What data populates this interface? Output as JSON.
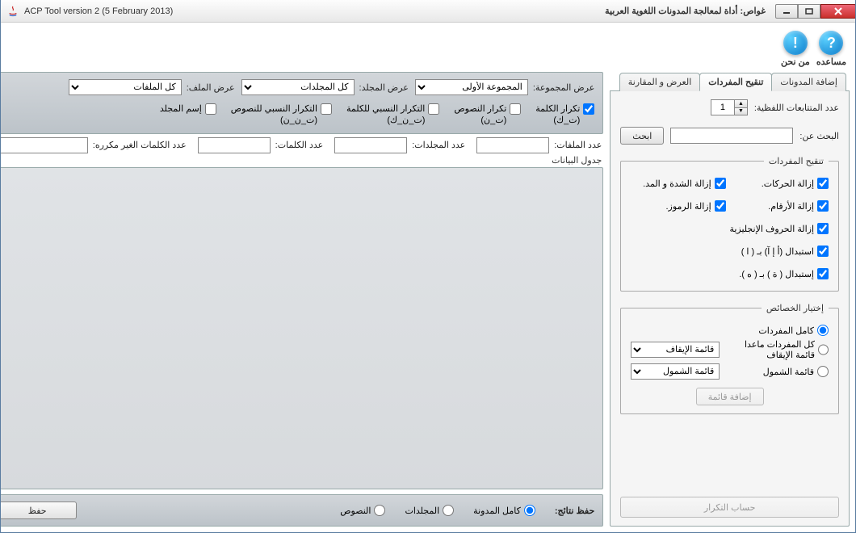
{
  "window": {
    "title_en": "ACP Tool version 2 (5 February 2013)",
    "title_ar": "غواص: أداة لمعالجة المدونات اللغوية العربية"
  },
  "help": {
    "help_label": "مساعده",
    "about_label": "من نحن"
  },
  "tabs": {
    "add_corpus": "إضافة المدونات",
    "refine_vocab": "تنقيح المفردات",
    "view_compare": "العرض و المقارنة"
  },
  "right": {
    "ngram_label": "عدد المتتابعات اللفظية:",
    "ngram_value": "1",
    "search_label": "البحث عن:",
    "search_value": "",
    "search_btn": "ابحث",
    "refine_legend": "تنقيح المفردات",
    "chk_diacritics": "إزالة الحركات.",
    "chk_shadda": "إزالة الشدة و المد.",
    "chk_numbers": "إزالة الأرقام.",
    "chk_symbols": "إزالة الرموز.",
    "chk_english": "إزالة الحروف الإنجليزية",
    "chk_alef": "استبدال (أ إ آ) بـ ( ا )",
    "chk_ta": "إستبدال ( ة ) بـ ( ه ).",
    "props_legend": "إختيار الخصائص",
    "radio_all": "كامل المفردات",
    "radio_except_stop": "كل المفردات ماعدا قائمة الإيقاف",
    "radio_include": "قائمة الشمول",
    "stop_list_sel": "قائمة الإيقاف",
    "include_list_sel": "قائمة الشمول",
    "add_list_btn": "إضافة قائمة",
    "compute_btn": "حساب التكرار"
  },
  "left": {
    "group_label": "عرض المجموعة:",
    "group_value": "المجموعة الأولى",
    "folder_label": "عرض المجلد:",
    "folder_value": "كل المجلدات",
    "file_label": "عرض الملف:",
    "file_value": "كل الملفات",
    "chk_word_freq": "تكرار الكلمة",
    "chk_word_freq_sub": "(ت_ك)",
    "chk_text_freq": "تكرار النصوص",
    "chk_text_freq_sub": "(ت_ن)",
    "chk_rel_word": "التكرار النسبي للكلمة",
    "chk_rel_word_sub": "(ت_ن_ك)",
    "chk_rel_text": "التكرار النسبي للنصوص",
    "chk_rel_text_sub": "(ت_ن_ن)",
    "chk_folder_name": "إسم المجلد",
    "stat_files": "عدد الملفات:",
    "stat_folders": "عدد المجلدات:",
    "stat_words": "عدد الكلمات:",
    "stat_unique": "عدد الكلمات الغير مكرره:",
    "table_label": "جدول البيانات",
    "save_results": "حفظ نتائج:",
    "radio_full_corpus": "كامل المدونة",
    "radio_folders": "المجلدات",
    "radio_texts": "النصوص",
    "save_btn": "حفظ"
  }
}
